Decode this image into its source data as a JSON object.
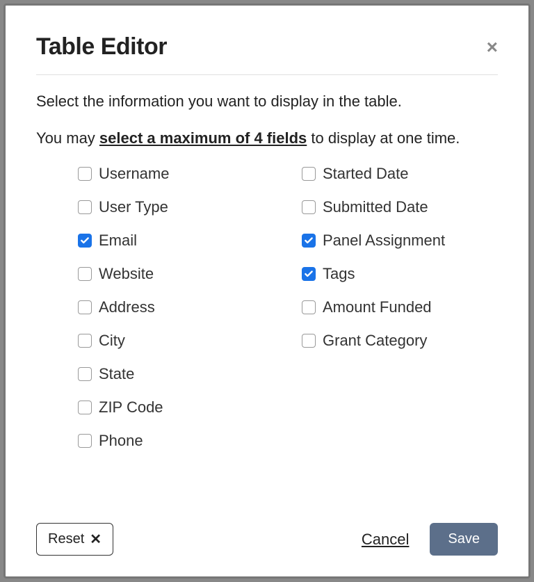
{
  "modal": {
    "title": "Table Editor",
    "instruction_prefix": "Select the information you want to display in the table.",
    "instruction_line2_a": "You may ",
    "instruction_line2_em": "select a maximum of 4 fields",
    "instruction_line2_b": " to display at one time."
  },
  "fields": {
    "left": [
      {
        "label": "Username",
        "checked": false
      },
      {
        "label": "User Type",
        "checked": false
      },
      {
        "label": "Email",
        "checked": true
      },
      {
        "label": "Website",
        "checked": false
      },
      {
        "label": "Address",
        "checked": false
      },
      {
        "label": "City",
        "checked": false
      },
      {
        "label": "State",
        "checked": false
      },
      {
        "label": "ZIP Code",
        "checked": false
      },
      {
        "label": "Phone",
        "checked": false
      }
    ],
    "right": [
      {
        "label": "Started Date",
        "checked": false
      },
      {
        "label": "Submitted Date",
        "checked": false
      },
      {
        "label": "Panel Assignment",
        "checked": true
      },
      {
        "label": "Tags",
        "checked": true
      },
      {
        "label": "Amount Funded",
        "checked": false
      },
      {
        "label": "Grant Category",
        "checked": false
      }
    ]
  },
  "buttons": {
    "reset": "Reset",
    "cancel": "Cancel",
    "save": "Save"
  }
}
